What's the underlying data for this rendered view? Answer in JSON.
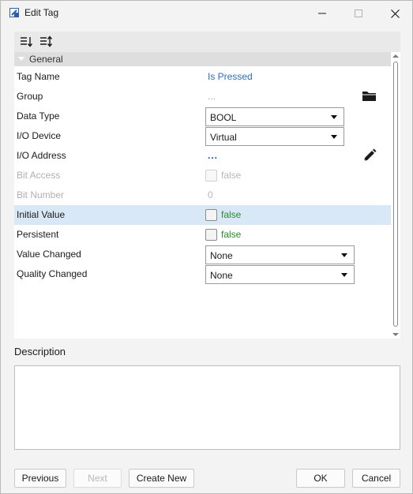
{
  "window": {
    "title": "Edit Tag",
    "icons": {
      "app": "app-icon",
      "minimize": "minimize-icon",
      "maximize": "maximize-icon",
      "close": "close-icon"
    }
  },
  "toolbar": {
    "sort_categorized_icon": "categorized-sort-icon",
    "sort_alpha_icon": "alphabetical-sort-icon"
  },
  "category": {
    "label": "General"
  },
  "properties": {
    "tag_name": {
      "label": "Tag Name",
      "value": "Is Pressed"
    },
    "group": {
      "label": "Group",
      "value": "...",
      "icon": "folder-icon"
    },
    "data_type": {
      "label": "Data Type",
      "value": "BOOL"
    },
    "io_device": {
      "label": "I/O Device",
      "value": "Virtual"
    },
    "io_address": {
      "label": "I/O Address",
      "value": "...",
      "icon": "pencil-edit-icon"
    },
    "bit_access": {
      "label": "Bit Access",
      "value": "false"
    },
    "bit_number": {
      "label": "Bit Number",
      "value": "0"
    },
    "initial_value": {
      "label": "Initial Value",
      "value": "false"
    },
    "persistent": {
      "label": "Persistent",
      "value": "false"
    },
    "value_changed": {
      "label": "Value Changed",
      "value": "None"
    },
    "quality_changed": {
      "label": "Quality Changed",
      "value": "None"
    }
  },
  "description": {
    "label": "Description",
    "value": ""
  },
  "buttons": {
    "previous": "Previous",
    "next": "Next",
    "create_new": "Create New",
    "ok": "OK",
    "cancel": "Cancel"
  },
  "colors": {
    "link": "#2a6ebd",
    "value_green": "#2a8a2a",
    "highlight_row": "#d9e8f6",
    "disabled": "#b0b0b0"
  }
}
